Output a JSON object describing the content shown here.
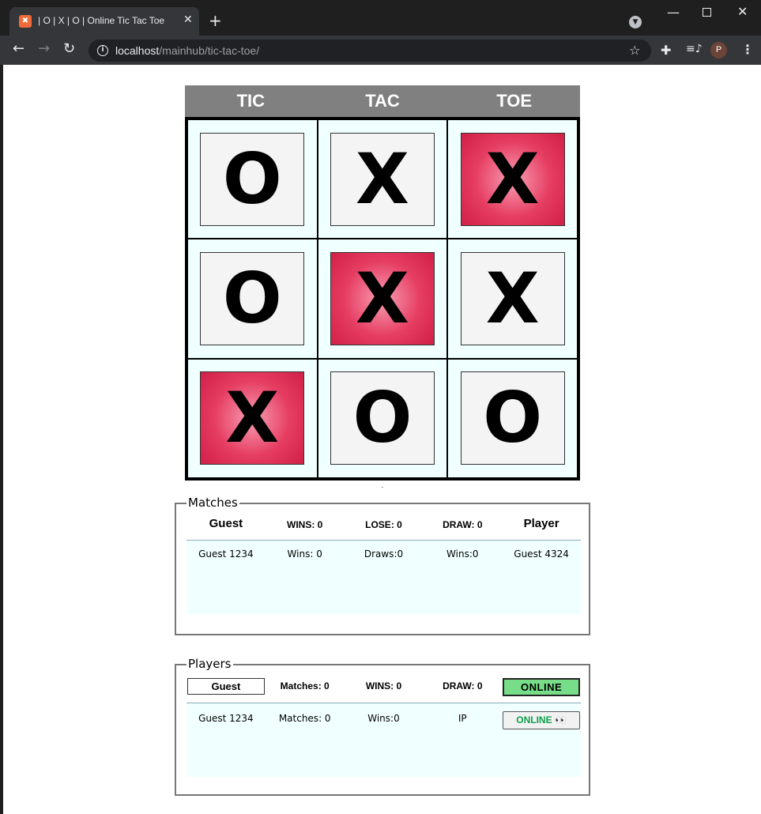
{
  "browser": {
    "tab_title": "| O | X | O | Online Tic Tac Toe",
    "url_host": "localhost",
    "url_path": "/mainhub/tic-tac-toe/",
    "profile_initial": "P"
  },
  "board": {
    "headers": [
      "TIC",
      "TAC",
      "TOE"
    ],
    "cells": [
      "O",
      "X",
      "X",
      "O",
      "X",
      "X",
      "X",
      "O",
      "O"
    ],
    "winning_cells": [
      2,
      4,
      6
    ],
    "win_color": "#e63d62"
  },
  "matches": {
    "legend": "Matches",
    "header": {
      "guest": "Guest",
      "wins": "WINS: 0",
      "lose": "LOSE: 0",
      "draw": "DRAW: 0",
      "player": "Player"
    },
    "row": {
      "guest": "Guest 1234",
      "wins": "Wins: 0",
      "draws": "Draws:0",
      "wins2": "Wins:0",
      "player": "Guest 4324"
    }
  },
  "players": {
    "legend": "Players",
    "header": {
      "guest": "Guest",
      "matches": "Matches: 0",
      "wins": "WINS: 0",
      "draw": "DRAW: 0",
      "status": "ONLINE"
    },
    "row": {
      "guest": "Guest 1234",
      "matches": "Matches: 0",
      "wins": "Wins:0",
      "ip": "IP",
      "status": "ONLINE",
      "status_emoji": "👀"
    },
    "online_color": "#77dd88"
  }
}
